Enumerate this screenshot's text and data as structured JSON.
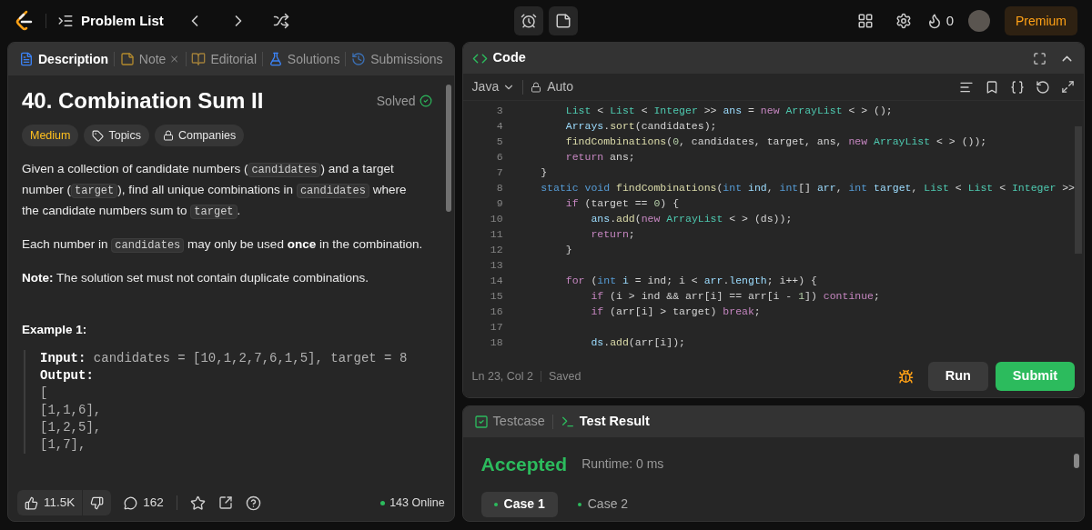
{
  "top_bar": {
    "problem_list": "Problem List",
    "streak": "0",
    "premium": "Premium"
  },
  "left_panel": {
    "tabs": [
      {
        "label": "Description",
        "selected": true
      },
      {
        "label": "Note",
        "selected": false,
        "closable": true
      },
      {
        "label": "Editorial",
        "selected": false
      },
      {
        "label": "Solutions",
        "selected": false
      },
      {
        "label": "Submissions",
        "selected": false
      }
    ],
    "title": "40. Combination Sum II",
    "solved": "Solved",
    "badges": [
      {
        "kind": "difficulty",
        "label": "Medium"
      },
      {
        "kind": "topics",
        "label": "Topics"
      },
      {
        "kind": "companies",
        "label": "Companies"
      }
    ],
    "paragraphs": [
      {
        "segments": [
          {
            "kind": "text",
            "text": "Given a collection of candidate numbers ("
          },
          {
            "kind": "code",
            "text": "candidates"
          },
          {
            "kind": "text",
            "text": ") and a target number ("
          },
          {
            "kind": "code",
            "text": "target"
          },
          {
            "kind": "text",
            "text": "), find all unique combinations in "
          },
          {
            "kind": "code",
            "text": "candidates"
          },
          {
            "kind": "text",
            "text": " where the candidate numbers sum to "
          },
          {
            "kind": "code",
            "text": "target"
          },
          {
            "kind": "text",
            "text": "."
          }
        ]
      },
      {
        "segments": [
          {
            "kind": "text",
            "text": "Each number in "
          },
          {
            "kind": "code",
            "text": "candidates"
          },
          {
            "kind": "text",
            "text": " may only be used "
          },
          {
            "kind": "bold",
            "text": "once"
          },
          {
            "kind": "text",
            "text": " in the combination."
          }
        ]
      },
      {
        "segments": [
          {
            "kind": "bold",
            "text": "Note:"
          },
          {
            "kind": "text",
            "text": " The solution set must not contain duplicate combinations."
          }
        ]
      }
    ],
    "example": {
      "title": "Example 1:",
      "input_label": "Input:",
      "input": "candidates = [10,1,2,7,6,1,5], target = 8",
      "output_label": "Output:",
      "output_lines": [
        "[",
        "[1,1,6],",
        "[1,2,5],",
        "[1,7],"
      ]
    },
    "footer": {
      "likes": "11.5K",
      "comments": "162",
      "online": "143 Online"
    }
  },
  "code_panel": {
    "title": "Code",
    "language": "Java",
    "mode": "Auto",
    "lines": [
      {
        "number": "3",
        "tokens": [
          {
            "kind": "type",
            "text": "        List"
          },
          {
            "kind": "plain",
            "text": " < "
          },
          {
            "kind": "type",
            "text": "List"
          },
          {
            "kind": "plain",
            "text": " < "
          },
          {
            "kind": "type",
            "text": "Integer"
          },
          {
            "kind": "plain",
            "text": " >> "
          },
          {
            "kind": "var",
            "text": "ans"
          },
          {
            "kind": "plain",
            "text": " = "
          },
          {
            "kind": "keyword",
            "text": "new"
          },
          {
            "kind": "type",
            "text": " ArrayList"
          },
          {
            "kind": "plain",
            "text": " < > ();"
          }
        ]
      },
      {
        "number": "4",
        "tokens": [
          {
            "kind": "var",
            "text": "        Arrays"
          },
          {
            "kind": "plain",
            "text": "."
          },
          {
            "kind": "function",
            "text": "sort"
          },
          {
            "kind": "plain",
            "text": "(candidates);"
          }
        ]
      },
      {
        "number": "5",
        "tokens": [
          {
            "kind": "function",
            "text": "        findCombinations"
          },
          {
            "kind": "plain",
            "text": "("
          },
          {
            "kind": "number",
            "text": "0"
          },
          {
            "kind": "plain",
            "text": ", candidates, target, ans, "
          },
          {
            "kind": "keyword",
            "text": "new"
          },
          {
            "kind": "type",
            "text": " ArrayList"
          },
          {
            "kind": "plain",
            "text": " < > ());"
          }
        ]
      },
      {
        "number": "6",
        "tokens": [
          {
            "kind": "keyword",
            "text": "        return"
          },
          {
            "kind": "plain",
            "text": " ans;"
          }
        ]
      },
      {
        "number": "7",
        "tokens": [
          {
            "kind": "plain",
            "text": "    }"
          }
        ]
      },
      {
        "number": "8",
        "tokens": [
          {
            "kind": "storage",
            "text": "    static"
          },
          {
            "kind": "storage",
            "text": " void"
          },
          {
            "kind": "function",
            "text": " findCombinations"
          },
          {
            "kind": "plain",
            "text": "("
          },
          {
            "kind": "storage",
            "text": "int"
          },
          {
            "kind": "var",
            "text": " ind"
          },
          {
            "kind": "plain",
            "text": ", "
          },
          {
            "kind": "storage",
            "text": "int"
          },
          {
            "kind": "plain",
            "text": "[] "
          },
          {
            "kind": "var",
            "text": "arr"
          },
          {
            "kind": "plain",
            "text": ", "
          },
          {
            "kind": "storage",
            "text": "int"
          },
          {
            "kind": "var",
            "text": " target"
          },
          {
            "kind": "plain",
            "text": ", "
          },
          {
            "kind": "type",
            "text": "List"
          },
          {
            "kind": "plain",
            "text": " < "
          },
          {
            "kind": "type",
            "text": "List"
          },
          {
            "kind": "plain",
            "text": " < "
          },
          {
            "kind": "type",
            "text": "Integer"
          },
          {
            "kind": "plain",
            "text": " >>"
          }
        ]
      },
      {
        "number": "9",
        "tokens": [
          {
            "kind": "keyword",
            "text": "        if"
          },
          {
            "kind": "plain",
            "text": " (target == "
          },
          {
            "kind": "number",
            "text": "0"
          },
          {
            "kind": "plain",
            "text": ") {"
          }
        ]
      },
      {
        "number": "10",
        "tokens": [
          {
            "kind": "var",
            "text": "            ans"
          },
          {
            "kind": "plain",
            "text": "."
          },
          {
            "kind": "function",
            "text": "add"
          },
          {
            "kind": "plain",
            "text": "("
          },
          {
            "kind": "keyword",
            "text": "new"
          },
          {
            "kind": "type",
            "text": " ArrayList"
          },
          {
            "kind": "plain",
            "text": " < > (ds));"
          }
        ]
      },
      {
        "number": "11",
        "tokens": [
          {
            "kind": "keyword",
            "text": "            return"
          },
          {
            "kind": "plain",
            "text": ";"
          }
        ]
      },
      {
        "number": "12",
        "tokens": [
          {
            "kind": "plain",
            "text": "        }"
          }
        ]
      },
      {
        "number": "13"
      },
      {
        "number": "14",
        "tokens": [
          {
            "kind": "keyword",
            "text": "        for"
          },
          {
            "kind": "plain",
            "text": " ("
          },
          {
            "kind": "storage",
            "text": "int"
          },
          {
            "kind": "var",
            "text": " i"
          },
          {
            "kind": "plain",
            "text": " = ind; i < "
          },
          {
            "kind": "var",
            "text": "arr"
          },
          {
            "kind": "plain",
            "text": "."
          },
          {
            "kind": "var",
            "text": "length"
          },
          {
            "kind": "plain",
            "text": "; i++) {"
          }
        ]
      },
      {
        "number": "15",
        "tokens": [
          {
            "kind": "keyword",
            "text": "            if"
          },
          {
            "kind": "plain",
            "text": " (i > ind && arr[i] == arr[i - "
          },
          {
            "kind": "number",
            "text": "1"
          },
          {
            "kind": "plain",
            "text": "]) "
          },
          {
            "kind": "keyword",
            "text": "continue"
          },
          {
            "kind": "plain",
            "text": ";"
          }
        ]
      },
      {
        "number": "16",
        "tokens": [
          {
            "kind": "keyword",
            "text": "            if"
          },
          {
            "kind": "plain",
            "text": " (arr[i] > target) "
          },
          {
            "kind": "keyword",
            "text": "break"
          },
          {
            "kind": "plain",
            "text": ";"
          }
        ]
      },
      {
        "number": "17"
      },
      {
        "number": "18",
        "tokens": [
          {
            "kind": "var",
            "text": "            ds"
          },
          {
            "kind": "plain",
            "text": "."
          },
          {
            "kind": "function",
            "text": "add"
          },
          {
            "kind": "plain",
            "text": "(arr[i]);"
          }
        ]
      }
    ],
    "cursor": "Ln 23, Col 2",
    "save_state": "Saved",
    "run": "Run",
    "submit": "Submit"
  },
  "result_panel": {
    "tabs": [
      {
        "label": "Testcase",
        "selected": false
      },
      {
        "label": "Test Result",
        "selected": true
      }
    ],
    "verdict": "Accepted",
    "runtime": "Runtime: 0 ms",
    "cases": [
      {
        "label": "Case 1",
        "selected": true,
        "passed": true
      },
      {
        "label": "Case 2",
        "selected": false,
        "passed": true
      }
    ]
  }
}
